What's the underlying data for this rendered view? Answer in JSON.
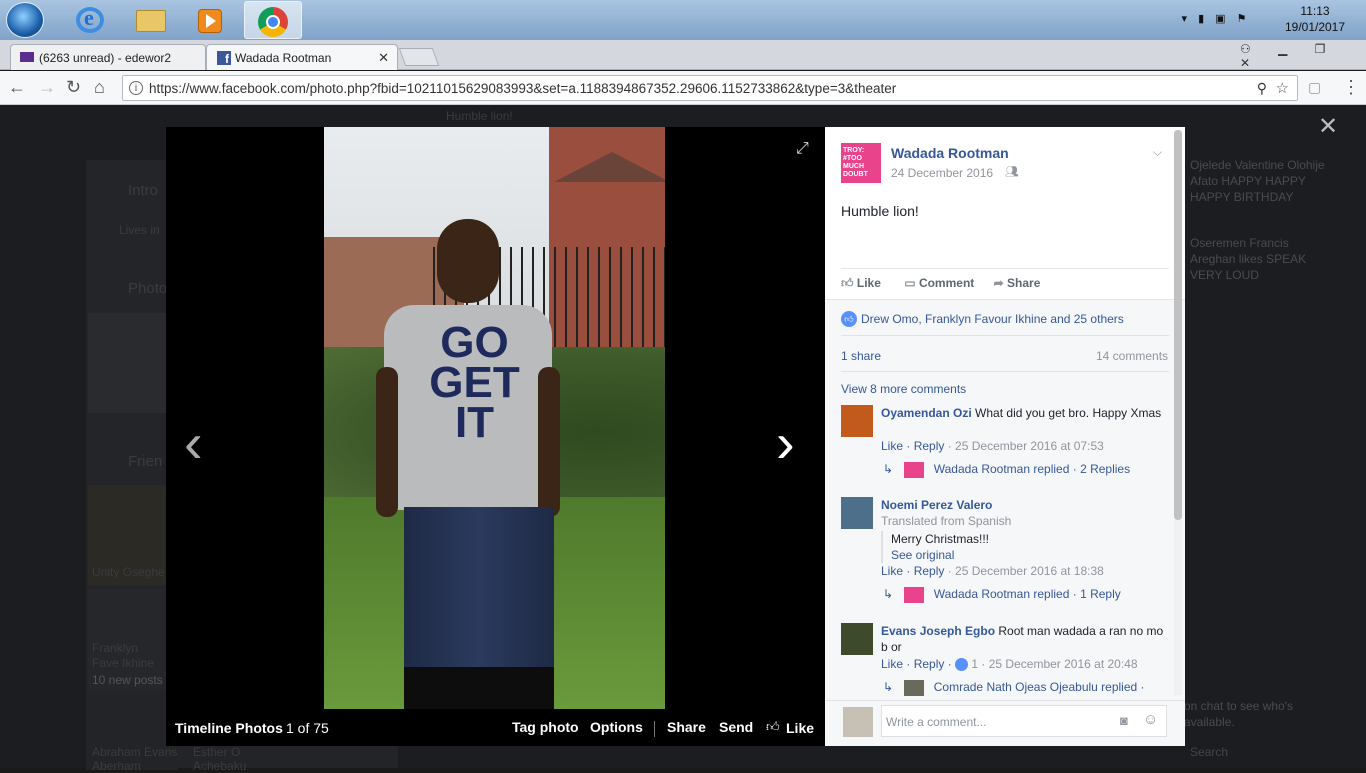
{
  "taskbar": {
    "time": "11:13",
    "date": "19/01/2017"
  },
  "tabs": [
    {
      "label": "(6263 unread) - edewor2"
    },
    {
      "label": "Wadada Rootman"
    }
  ],
  "omnibox": {
    "url": "https://www.facebook.com/photo.php?fbid=10211015629083993&set=a.1188394867352.29606.1152733862&type=3&theater"
  },
  "background": {
    "intro": "Intro",
    "lives": "Lives in",
    "photos": "Photo",
    "friends": "Frien",
    "f1": "Unity Oseghe",
    "f2": "Franklyn Fave Ikhine",
    "f2sub": "10 new posts",
    "f3": "Abraham Evans Aberham",
    "f4": "Esther O Achebaku",
    "post_top": "Humble lion!",
    "ticker1a": "Ojelede Valentine",
    "ticker1b": "Olohije Afato",
    "ticker1c": "HAPPY HAPPY HAPPY BIRTHDAY",
    "ticker2a": "Oseremen Francis Areghan",
    "ticker2b": "likes SPEAK VERY LOUD",
    "chat_hint": "on chat to see who's available.",
    "search": "Search"
  },
  "viewer": {
    "album": "Timeline Photos",
    "count": "1 of 75",
    "tag": "Tag photo",
    "options": "Options",
    "share": "Share",
    "send": "Send",
    "like": "Like"
  },
  "post": {
    "author": "Wadada Rootman",
    "avatar_text": "TROY: #TOO MUCH DOUBT",
    "date": "24 December 2016",
    "caption": "Humble lion!",
    "like": "Like",
    "comment": "Comment",
    "share": "Share",
    "likers": "Drew Omo, Franklyn Favour Ikhine and 25 others",
    "shares": "1 share",
    "comments_count": "14 comments",
    "more": "View 8 more comments",
    "write": "Write a comment..."
  },
  "comments": [
    {
      "name": "Oyamendan Ozi",
      "text": "What did you get bro. Happy Xmas",
      "like": "Like",
      "reply": "Reply",
      "meta": "· 25 December 2016 at 07:53",
      "replier": "Wadada Rootman replied",
      "replies": "· 2 Replies"
    },
    {
      "name": "Noemi Perez Valero",
      "translated": "Translated from Spanish",
      "text": "Merry Christmas!!!",
      "see": "See original",
      "like": "Like",
      "reply": "Reply",
      "meta": "· 25 December 2016 at 18:38",
      "replier": "Wadada Rootman replied",
      "replies": "· 1 Reply"
    },
    {
      "name": "Evans Joseph Egbo",
      "text": "Root man wadada a ran no mo b or",
      "like": "Like",
      "reply": "Reply",
      "likes": "1",
      "meta": "· 25 December 2016 at 20:48",
      "replier": "Comrade Nath Ojeas Ojeabulu replied",
      "replies": "·"
    }
  ],
  "colors": {
    "fb_blue": "#365899",
    "accent_pink": "#e8438b"
  }
}
